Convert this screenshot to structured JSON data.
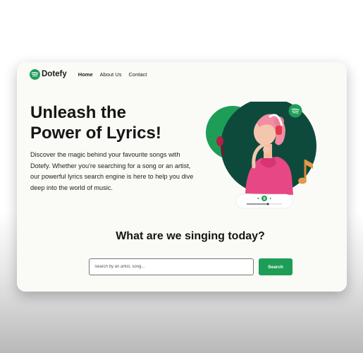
{
  "colors": {
    "brand_green": "#1e9d57",
    "dark_green": "#0e4a3c",
    "card_bg": "#fafaf6",
    "text_dark": "#151515"
  },
  "nav": {
    "brand": "Dotefy",
    "logo_icon": "spotify-like-logo-icon",
    "links": [
      {
        "label": "Home",
        "active": true
      },
      {
        "label": "About Us",
        "active": false
      },
      {
        "label": "Contact",
        "active": false
      }
    ]
  },
  "hero": {
    "headline_line1": "Unleash the",
    "headline_line2": "Power of Lyrics!",
    "description": "Discover the magic behind your favourite songs with Dotefy. Whether you're searching for a song or an artist, our powerful lyrics search engine is here to help you dive deep into the world of music.",
    "image": "woman-with-headphones-illustration"
  },
  "search": {
    "title": "What are we singing today?",
    "placeholder": "Search by an artist, song...",
    "value": "",
    "button_label": "Search"
  }
}
